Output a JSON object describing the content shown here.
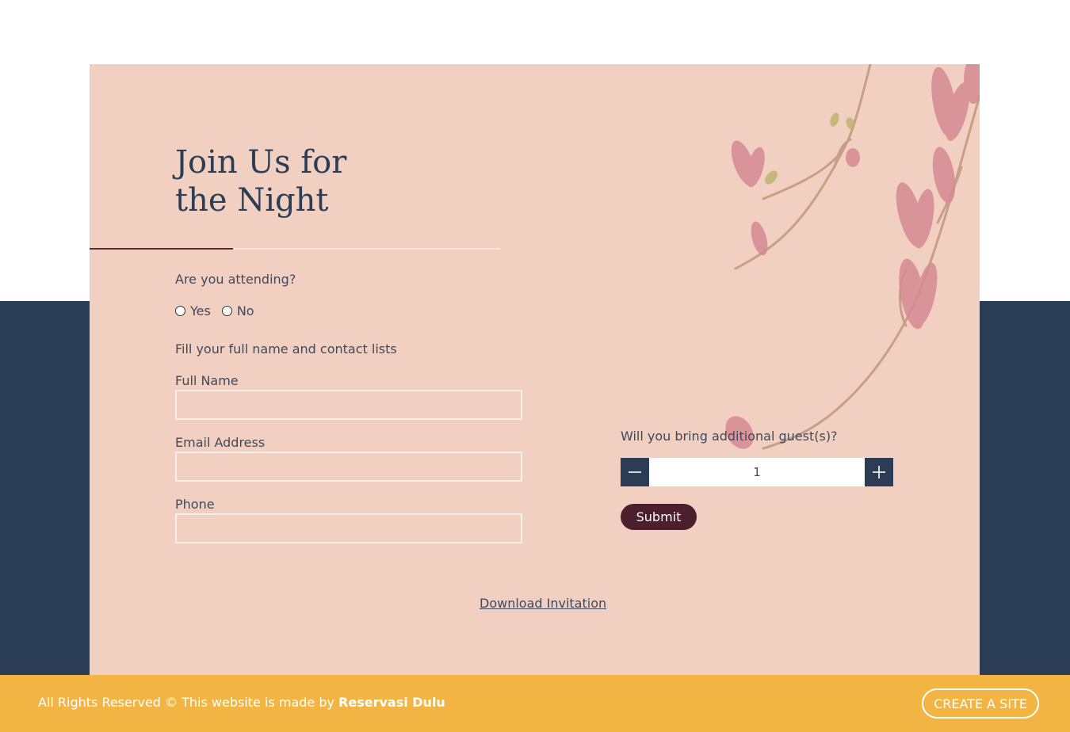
{
  "colors": {
    "card_background": "#f1d0c2",
    "navy": "#2a3d55",
    "footer": "#f2b544",
    "submit": "#4d1f2d"
  },
  "form": {
    "title_line1": "Join Us for",
    "title_line2": "the Night",
    "attending_question": "Are you attending?",
    "options": [
      "Yes",
      "No"
    ],
    "contact_heading": "Fill your full name and contact lists",
    "full_name_label": "Full Name",
    "full_name_value": "",
    "email_label": "Email Address",
    "email_value": "",
    "phone_label": "Phone",
    "phone_value": "",
    "guests_question": "Will you bring additional guest(s)?",
    "guests_value": "1",
    "minus_icon": "minus-icon",
    "plus_icon": "plus-icon",
    "submit_label": "Submit",
    "download_label": "Download Invitation"
  },
  "footer": {
    "text_prefix": "All Rights Reserved © This website is made by ",
    "brand": "Reservasi Dulu",
    "create_site_label": "CREATE A SITE"
  }
}
